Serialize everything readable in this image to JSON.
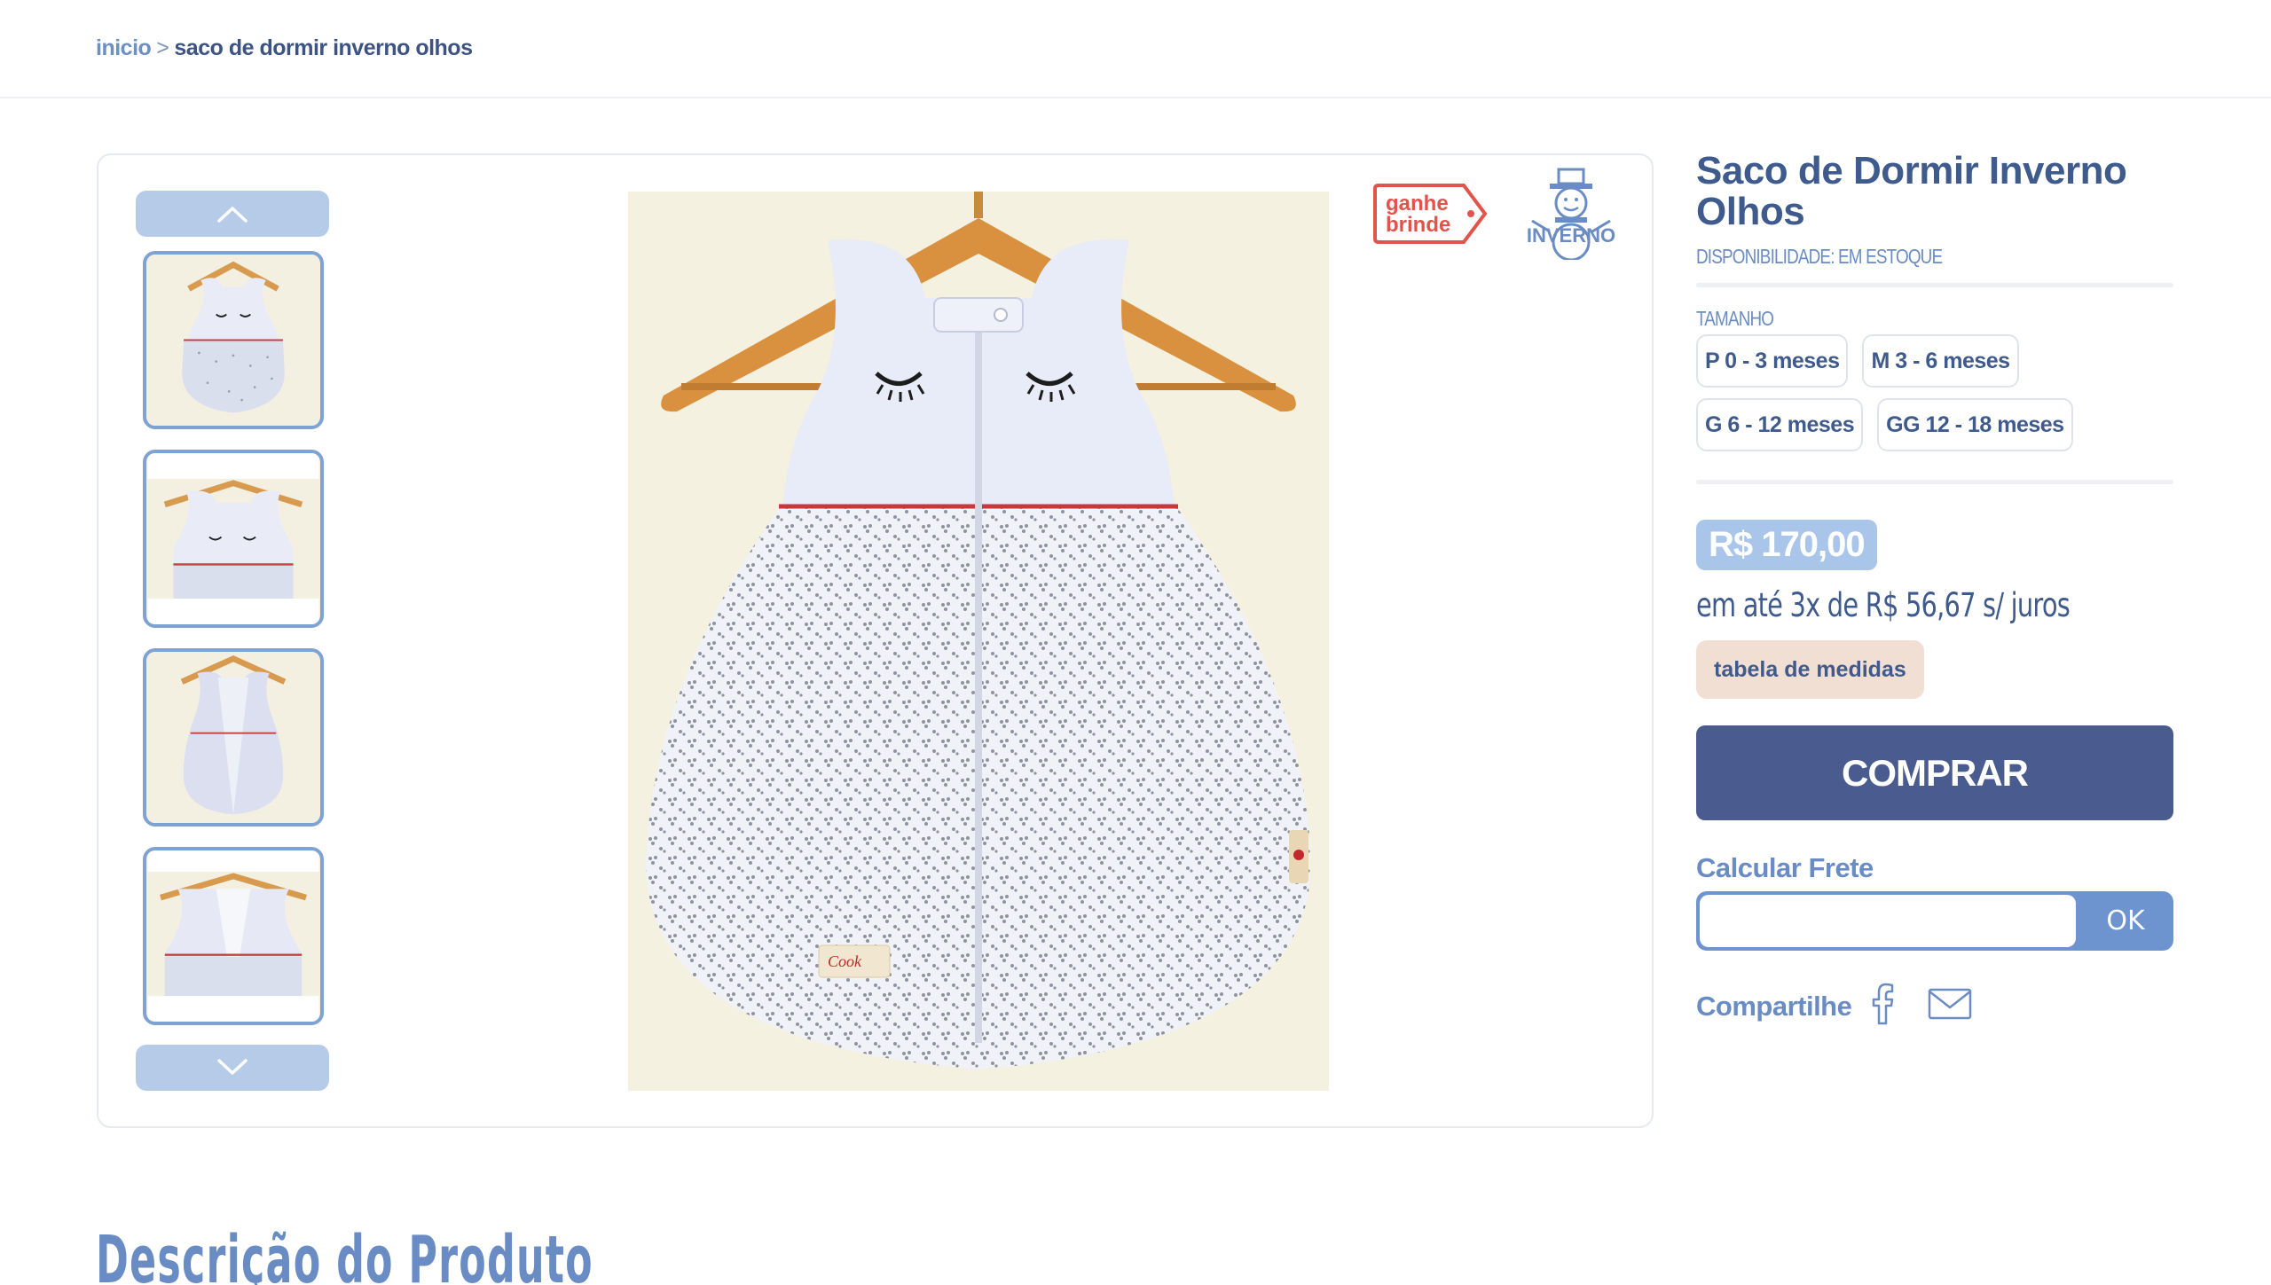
{
  "breadcrumb": {
    "home": "inicio",
    "separator": ">",
    "current": "saco de dormir inverno olhos"
  },
  "gallery": {
    "up_icon": "chevron-up-icon",
    "down_icon": "chevron-down-icon",
    "thumbnails": [
      "thumbnail-front",
      "thumbnail-closeup",
      "thumbnail-open",
      "thumbnail-open-closeup"
    ],
    "badge_brinde": "ganhe brinde",
    "badge_brinde_line1": "ganhe",
    "badge_brinde_line2": "brinde",
    "badge_inverno": "INVERNO",
    "label_tag_text": "Cook"
  },
  "product": {
    "title": "Saco de Dormir Inverno Olhos",
    "availability": "DISPONIBILIDADE: EM ESTOQUE",
    "size_label": "TAMANHO",
    "sizes": [
      "P 0 - 3 meses",
      "M 3 - 6 meses",
      "G 6 - 12 meses",
      "GG 12 - 18 meses"
    ],
    "price": "R$ 170,00",
    "installments": "em até 3x de R$ 56,67 s/ juros",
    "size_chart_label": "tabela de medidas",
    "buy_label": "COMPRAR",
    "shipping_label": "Calcular Frete",
    "shipping_placeholder": "",
    "shipping_ok": "OK",
    "share_label": "Compartilhe"
  },
  "description_heading": "Descrição do Produto",
  "colors": {
    "primary": "#495b8f",
    "accent": "#6d94cf",
    "price_bg": "#a9c6ea",
    "size_chart_bg": "#f2dfd3",
    "brinde_red": "#e2534a"
  }
}
